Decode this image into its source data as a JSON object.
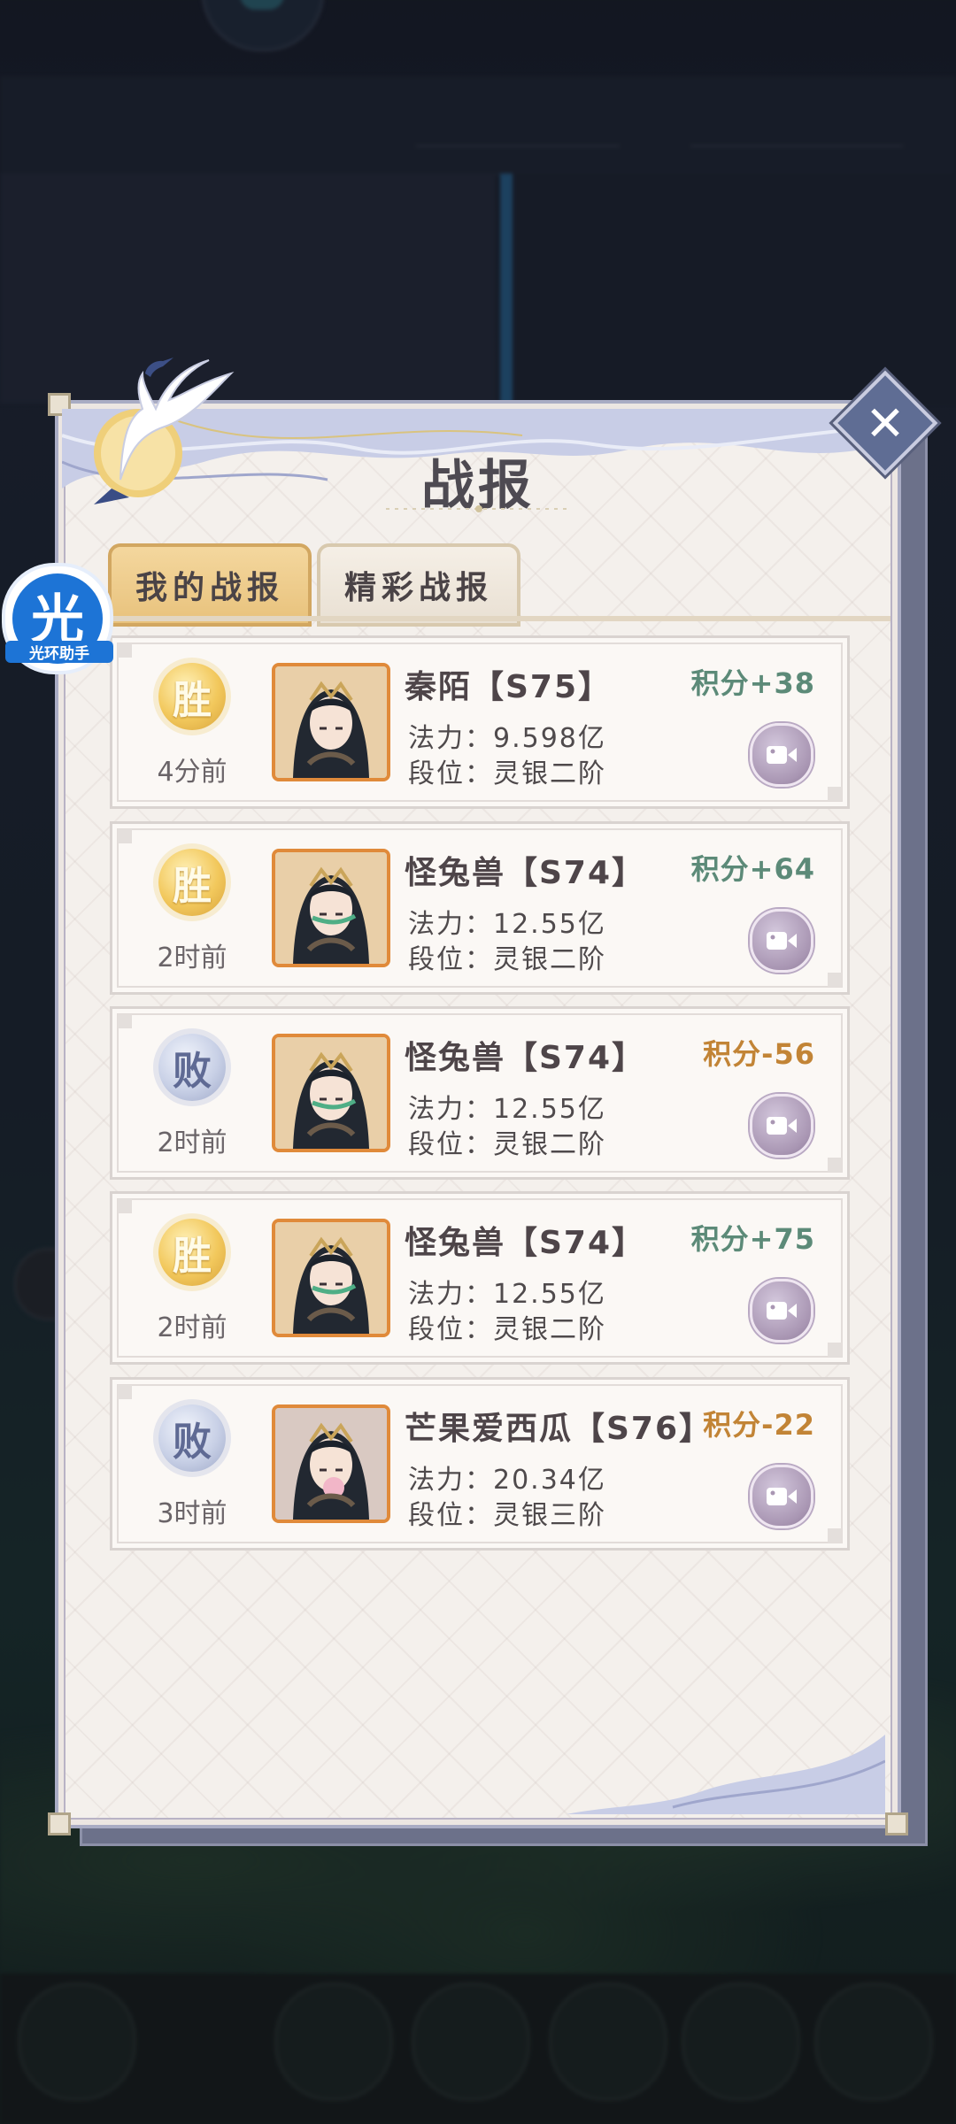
{
  "dialog": {
    "title": "战报",
    "close_symbol": "✕"
  },
  "tabs": [
    {
      "label": "我的战报",
      "active": true
    },
    {
      "label": "精彩战报",
      "active": false
    }
  ],
  "labels": {
    "power": "法力：",
    "rank": "段位："
  },
  "reports": [
    {
      "result": "胜",
      "outcome": "win",
      "time": "4分前",
      "name": "秦陌【S75】",
      "score": "积分+38",
      "power": "9.598亿",
      "rank": "灵银二阶"
    },
    {
      "result": "胜",
      "outcome": "win",
      "time": "2时前",
      "name": "怪兔兽【S74】",
      "score": "积分+64",
      "power": "12.55亿",
      "rank": "灵银二阶"
    },
    {
      "result": "败",
      "outcome": "lose",
      "time": "2时前",
      "name": "怪兔兽【S74】",
      "score": "积分-56",
      "power": "12.55亿",
      "rank": "灵银二阶"
    },
    {
      "result": "胜",
      "outcome": "win",
      "time": "2时前",
      "name": "怪兔兽【S74】",
      "score": "积分+75",
      "power": "12.55亿",
      "rank": "灵银二阶"
    },
    {
      "result": "败",
      "outcome": "lose",
      "time": "3时前",
      "name": "芒果爱西瓜【S76】",
      "score": "积分-22",
      "power": "20.34亿",
      "rank": "灵银三阶"
    }
  ],
  "assistant": {
    "glyph": "光",
    "label": "光环助手"
  },
  "colors": {
    "win_score": "#5c8a78",
    "lose_score": "#c28436",
    "tab_active": "#f4d79e",
    "close_button": "#5f6d94"
  },
  "icons": {
    "close": "close-icon",
    "replay": "video-replay-icon",
    "crane": "crane-decoration-icon"
  }
}
